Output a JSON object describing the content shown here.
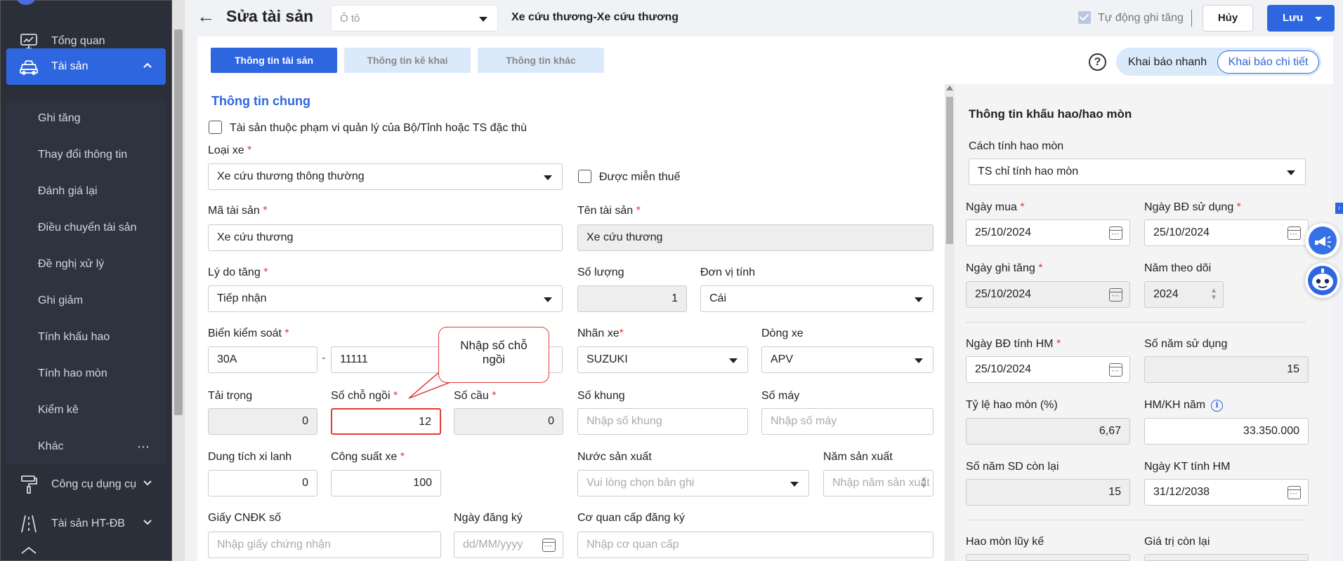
{
  "sidebar": {
    "items": [
      {
        "label": "Tổng quan",
        "icon": "dashboard-icon"
      },
      {
        "label": "Tài sản",
        "icon": "car-icon"
      },
      {
        "label": "Công cụ dụng cụ",
        "icon": "paint-roller-icon"
      },
      {
        "label": "Tài sản HT-ĐB",
        "icon": "road-icon"
      }
    ],
    "subitems": [
      "Ghi tăng",
      "Thay đổi thông tin",
      "Đánh giá lại",
      "Điều chuyển tài sản",
      "Đề nghị xử lý",
      "Ghi giảm",
      "Tính khấu hao",
      "Tính hao mòn",
      "Kiểm kê",
      "Khác"
    ],
    "more_glyph": "⋯"
  },
  "header": {
    "back_glyph": "←",
    "title": "Sửa tài sản",
    "type_placeholder": "Ô tô",
    "asset_name": "Xe cứu thương-Xe cứu thương",
    "auto_label": "Tự động ghi tăng",
    "cancel_label": "Hủy",
    "save_label": "Lưu"
  },
  "tabs": [
    "Thông tin tài sản",
    "Thông tin kê khai",
    "Thông tin khác"
  ],
  "mode": {
    "help": "?",
    "quick": "Khai báo nhanh",
    "detail": "Khai báo chi tiết"
  },
  "form": {
    "section_title": "Thông tin chung",
    "special_scope_label": "Tài sản thuộc phạm vi quản lý của Bộ/Tỉnh hoặc TS đặc thù",
    "vehicle_type_label": "Loại xe",
    "vehicle_type_value": "Xe cứu thương thông thường",
    "tax_exempt_label": "Được miễn thuế",
    "asset_code_label": "Mã tài sản",
    "asset_code_value": "Xe cứu thương",
    "asset_name_label": "Tên tài sản",
    "asset_name_value": "Xe cứu thương",
    "reason_label": "Lý do tăng",
    "reason_value": "Tiếp nhận",
    "quantity_label": "Số lượng",
    "quantity_value": "1",
    "unit_label": "Đơn vị tính",
    "unit_value": "Cái",
    "plate_label": "Biển kiểm soát",
    "plate_prefix": "30A",
    "plate_sep": "-",
    "plate_number": "11111",
    "brand_label": "Nhãn xe",
    "brand_value": "SUZUKI",
    "model_label": "Dòng xe",
    "model_value": "APV",
    "load_label": "Tải trọng",
    "load_value": "0",
    "seats_label": "Số chỗ ngồi",
    "seats_value": "12",
    "axles_label": "Số cầu",
    "axles_value": "0",
    "chassis_label": "Số khung",
    "chassis_placeholder": "Nhập số khung",
    "engine_label": "Số máy",
    "engine_placeholder": "Nhập số máy",
    "displacement_label": "Dung tích xi lanh",
    "displacement_value": "0",
    "power_label": "Công suất xe",
    "power_value": "100",
    "country_label": "Nước sản xuất",
    "country_placeholder": "Vui lòng chọn bản ghi",
    "year_label": "Năm sản xuất",
    "year_placeholder": "Nhập năm sản xuất",
    "reg_cert_label": "Giấy CNĐK số",
    "reg_cert_placeholder": "Nhập giấy chứng nhận",
    "reg_date_label": "Ngày đăng ký",
    "reg_date_placeholder": "dd/MM/yyyy",
    "reg_agency_label": "Cơ quan cấp đăng ký",
    "reg_agency_placeholder": "Nhập cơ quan cấp"
  },
  "callout": {
    "line1": "Nhập số chỗ",
    "line2": "ngồi"
  },
  "depreciation": {
    "title": "Thông tin khấu hao/hao mòn",
    "method_label": "Cách tính hao mòn",
    "method_value": "TS chỉ tính hao mòn",
    "purchase_date_label": "Ngày mua",
    "purchase_date_value": "25/10/2024",
    "use_start_label": "Ngày BĐ sử dụng",
    "use_start_value": "25/10/2024",
    "increase_date_label": "Ngày ghi tăng",
    "increase_date_value": "25/10/2024",
    "tracking_year_label": "Năm theo dõi",
    "tracking_year_value": "2024",
    "hm_start_label": "Ngày BĐ tính HM",
    "hm_start_value": "25/10/2024",
    "use_years_label": "Số năm sử dụng",
    "use_years_value": "15",
    "rate_label": "Tỷ lệ hao mòn (%)",
    "rate_value": "6,67",
    "annual_label": "HM/KH năm",
    "annual_value": "33.350.000",
    "remaining_label": "Số năm SD còn lại",
    "remaining_value": "15",
    "hm_end_label": "Ngày KT tính HM",
    "hm_end_value": "31/12/2038",
    "accumulated_label": "Hao mòn lũy kế",
    "residual_label": "Giá trị còn lại"
  },
  "colors": {
    "accent": "#2e66e0",
    "sidebar": "#2b2f3a",
    "required": "#e53935"
  }
}
